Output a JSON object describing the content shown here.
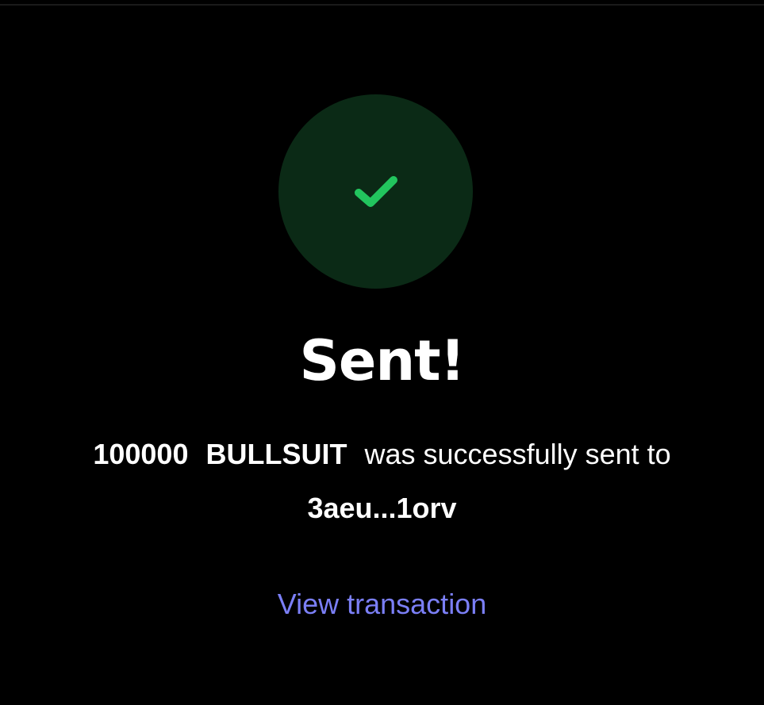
{
  "status": {
    "icon": "check-icon",
    "circle_color": "#0b2a16",
    "check_color": "#22c55e"
  },
  "title": "Sent!",
  "message": {
    "amount": "100000",
    "token": "BULLSUIT",
    "text": "was successfully sent to",
    "recipient": "3aeu...1orv"
  },
  "link": {
    "label": "View transaction",
    "color": "#7b7ff7"
  }
}
